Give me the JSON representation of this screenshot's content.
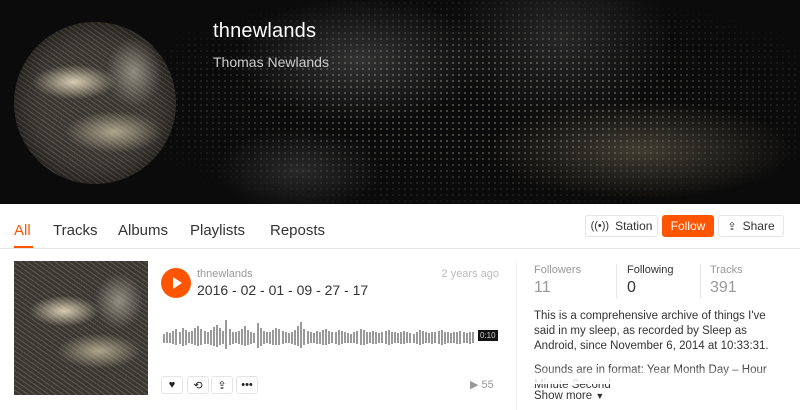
{
  "profile": {
    "username": "thnewlands",
    "real_name": "Thomas Newlands"
  },
  "tabs": [
    {
      "label": "All",
      "active": true
    },
    {
      "label": "Tracks"
    },
    {
      "label": "Albums"
    },
    {
      "label": "Playlists"
    },
    {
      "label": "Reposts"
    }
  ],
  "actions": {
    "station_label": "Station",
    "follow_label": "Follow",
    "share_label": "Share"
  },
  "track": {
    "user": "thnewlands",
    "title": "2016 - 02 - 01 - 09 - 27 - 17",
    "age": "2 years ago",
    "duration": "0:10",
    "plays": "55",
    "waveform": [
      8,
      10,
      9,
      12,
      14,
      11,
      16,
      13,
      10,
      12,
      15,
      18,
      14,
      12,
      11,
      13,
      17,
      20,
      15,
      12,
      26,
      14,
      11,
      10,
      12,
      14,
      18,
      13,
      11,
      9,
      22,
      16,
      12,
      10,
      11,
      13,
      15,
      14,
      12,
      10,
      9,
      11,
      13,
      18,
      24,
      14,
      12,
      10,
      9,
      12,
      11,
      13,
      14,
      12,
      10,
      11,
      13,
      12,
      10,
      9,
      8,
      10,
      12,
      14,
      13,
      11,
      10,
      12,
      11,
      9,
      10,
      12,
      13,
      11,
      10,
      9,
      11,
      12,
      10,
      9,
      8,
      11,
      13,
      12,
      10,
      9,
      11,
      10,
      12,
      13,
      11,
      10,
      9,
      10,
      11,
      12,
      10,
      9,
      11,
      10
    ]
  },
  "stats": {
    "followers_label": "Followers",
    "followers": "11",
    "following_label": "Following",
    "following": "0",
    "tracks_label": "Tracks",
    "tracks": "391"
  },
  "bio": {
    "paragraph1": "This is a comprehensive archive of things I've said in my sleep, as recorded by Sleep as Android, since November 6, 2014 at 10:33:31.",
    "paragraph2": "Sounds are in format: Year Month Day – Hour Minute Second",
    "show_more": "Show more"
  },
  "colors": {
    "accent": "#ff5500"
  }
}
